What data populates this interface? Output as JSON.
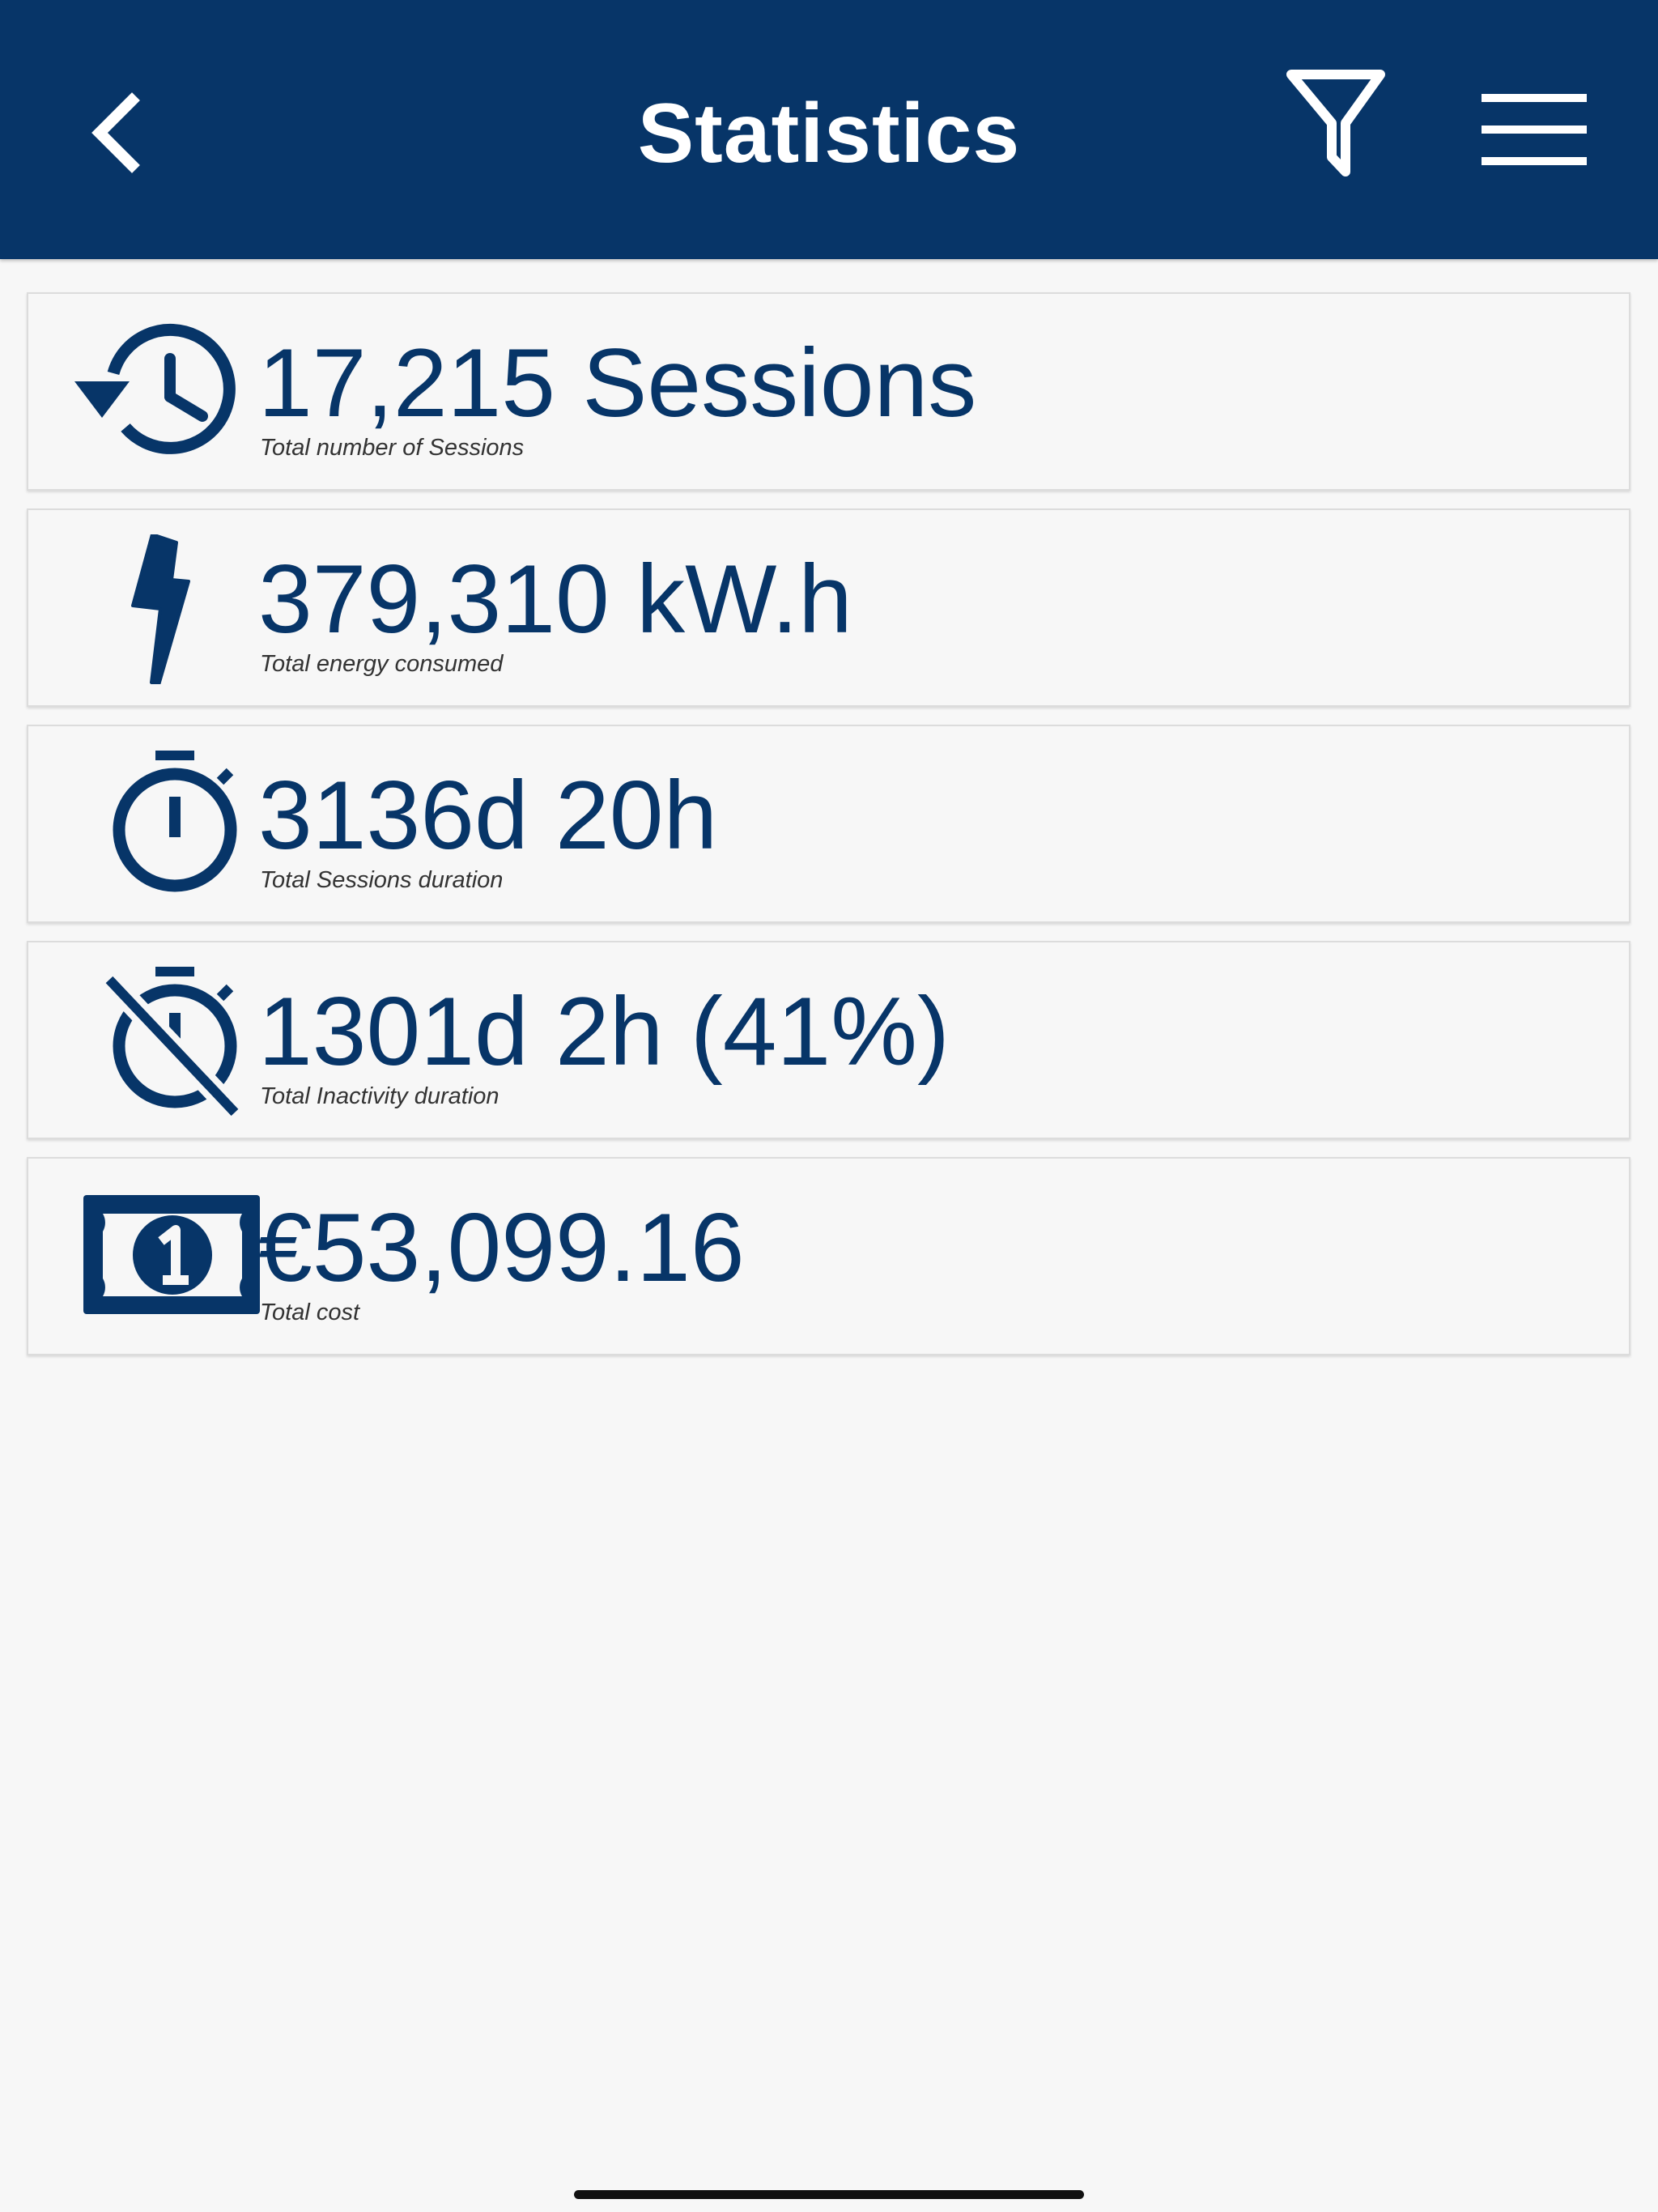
{
  "header": {
    "title": "Statistics",
    "back_icon": "chevron-left-icon",
    "filter_icon": "filter-icon",
    "menu_icon": "hamburger-menu-icon",
    "background_color": "#073568"
  },
  "stats": [
    {
      "icon": "history-icon",
      "value": "17,215 Sessions",
      "label": "Total number of Sessions"
    },
    {
      "icon": "lightning-bolt-icon",
      "value": "379,310 kW.h",
      "label": "Total energy consumed"
    },
    {
      "icon": "stopwatch-icon",
      "value": "3136d 20h",
      "label": "Total Sessions duration"
    },
    {
      "icon": "stopwatch-off-icon",
      "value": "1301d 2h  (41%)",
      "label": "Total Inactivity duration"
    },
    {
      "icon": "banknote-icon",
      "value": "€53,099.16",
      "label": "Total cost"
    }
  ],
  "colors": {
    "accent": "#073568",
    "background": "#f7f7f7"
  }
}
